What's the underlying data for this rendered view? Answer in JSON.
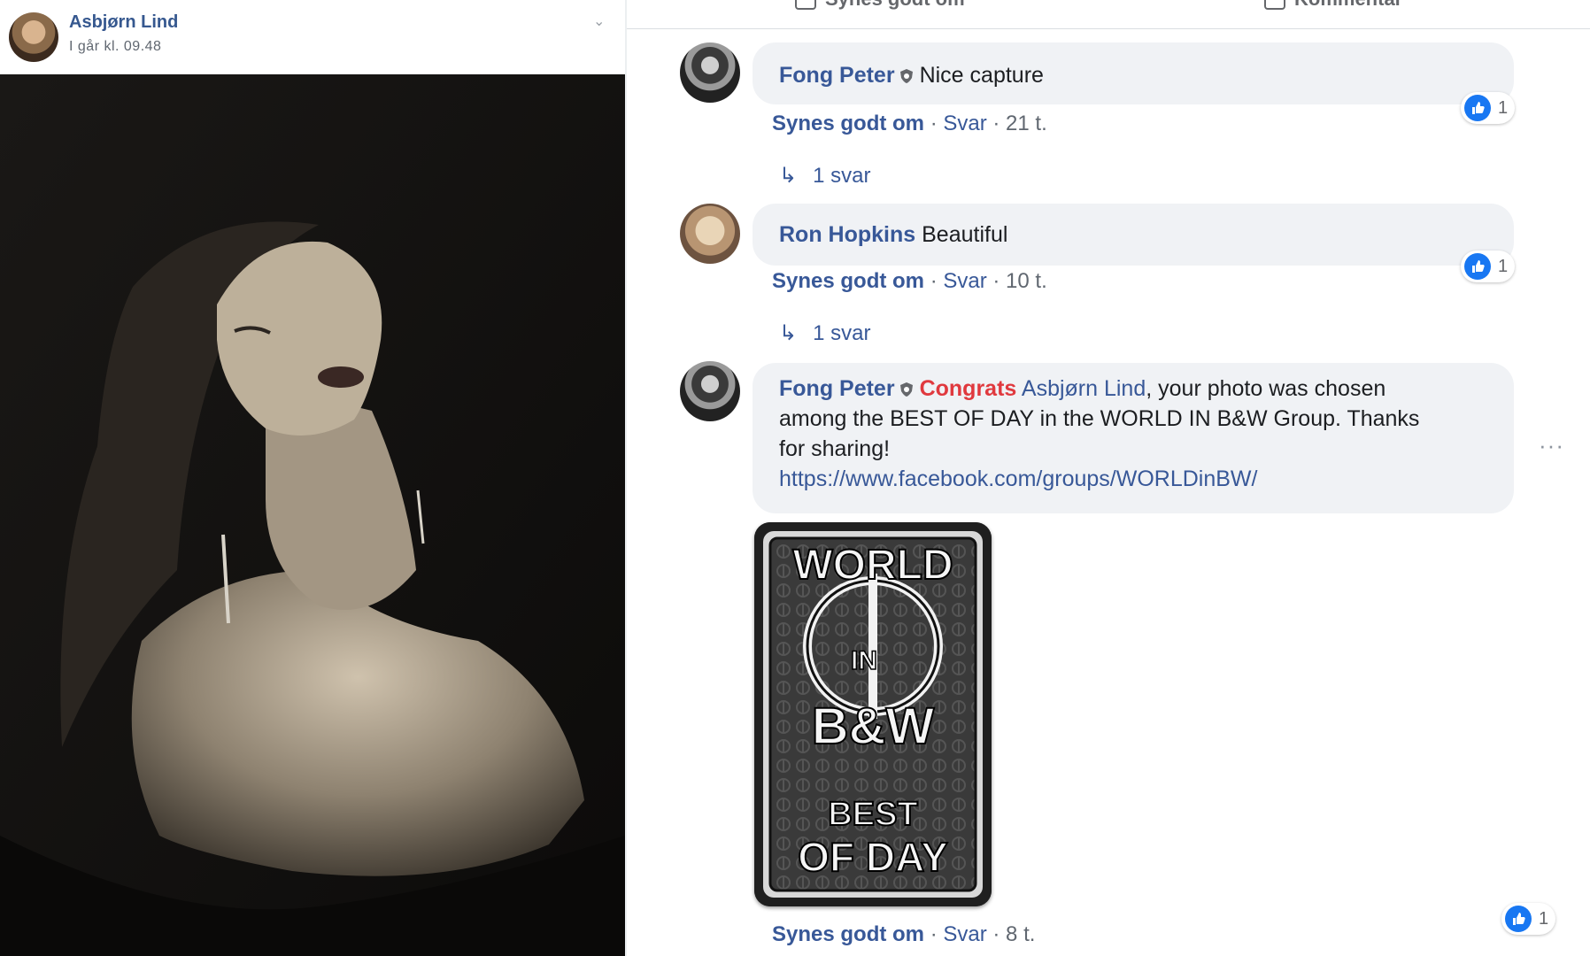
{
  "post": {
    "author": "Asbjørn Lind",
    "time": "I går kl. 09.48"
  },
  "topbar": {
    "share_label": "Synes godt om",
    "comment_label": "Kommentar"
  },
  "comments": [
    {
      "author": "Fong Peter",
      "text": "Nice capture",
      "like_label": "Synes godt om",
      "reply_label": "Svar",
      "time": "21 t.",
      "reactions": "1",
      "replies": "1 svar"
    },
    {
      "author": "Ron Hopkins",
      "text": "Beautiful",
      "like_label": "Synes godt om",
      "reply_label": "Svar",
      "time": "10 t.",
      "reactions": "1",
      "replies": "1 svar"
    },
    {
      "author": "Fong Peter",
      "highlight": "Congrats",
      "mention": "Asbjørn Lind",
      "text_part1": ", your photo was chosen",
      "text_part2": "among the BEST OF DAY in the WORLD IN B&W Group. Thanks",
      "text_part3": "for sharing!",
      "link": "https://www.facebook.com/groups/WORLDinBW/",
      "like_label": "Synes godt om",
      "reply_label": "Svar",
      "time": "8 t.",
      "reactions": "1"
    }
  ],
  "sticker": {
    "line1": "WORLD",
    "line2": "IN",
    "line3": "B&W",
    "line4": "BEST",
    "line5": "OF DAY"
  },
  "colors": {
    "name_blue": "#385898",
    "highlight_red": "#e0393e",
    "bubble_bg": "#f0f2f5",
    "like_blue": "#1877f2"
  }
}
